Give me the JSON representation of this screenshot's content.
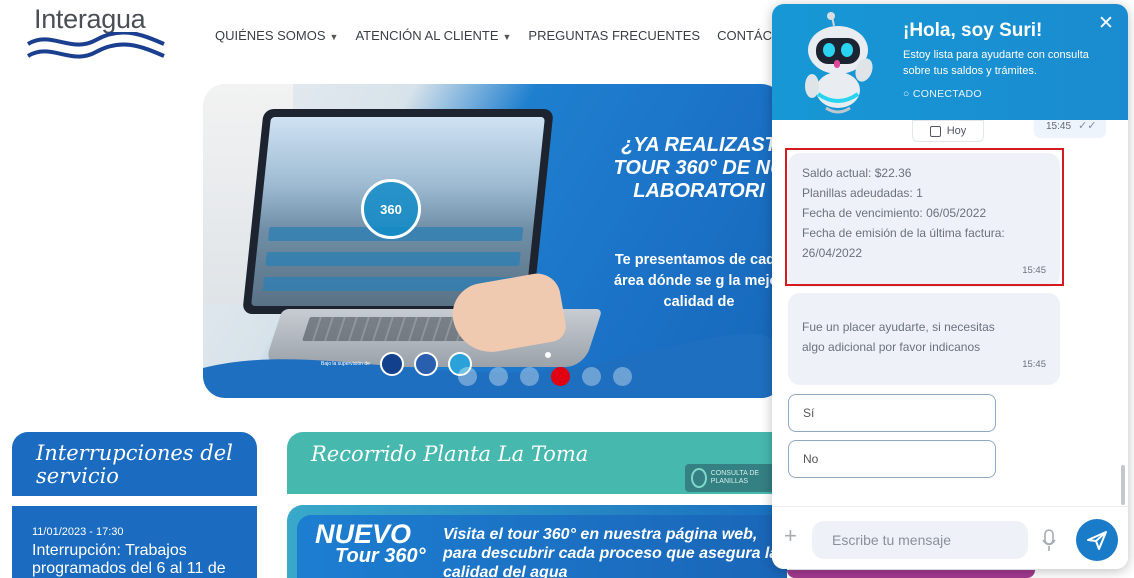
{
  "header": {
    "logo_text": "Interagua",
    "nav": [
      {
        "label": "QUIÉNES SOMOS",
        "dropdown": true
      },
      {
        "label": "ATENCIÓN AL CLIENTE",
        "dropdown": true
      },
      {
        "label": "PREGUNTAS FRECUENTES",
        "dropdown": false
      },
      {
        "label": "CONTÁCTANOS",
        "dropdown": true
      }
    ]
  },
  "hero": {
    "title": "¿YA REALIZAST TOUR 360° DE NU LABORATORI",
    "subtitle": "Te presentamos de cada área dónde se g la mejor calidad de",
    "badge": "360",
    "slides": 6,
    "active_slide": 4,
    "small_text": "Bajo la supervisión de"
  },
  "interruptions": {
    "title": "Interrupciones del servicio",
    "date": "11/01/2023 - 17:30",
    "text": "Interrupción: Trabajos programados del 6 al 11 de"
  },
  "recorrido": {
    "title": "Recorrido Planta La Toma",
    "consulta": "CONSULTA DE PLANILLAS"
  },
  "tour_banner": {
    "nuevo": "NUEVO",
    "tour": "Tour 360°",
    "text": "Visita el tour 360° en nuestra página web, para descubrir cada proceso que asegura la calidad del agua"
  },
  "chat": {
    "hello": "¡Hola, soy Suri!",
    "description": "Estoy lista para ayudarte con consulta sobre tus saldos y trámites.",
    "status": "○ CONECTADO",
    "close": "✕",
    "date_chip": "Hoy",
    "sent_time": "15:45",
    "sent_check": "✓✓",
    "balance_message": {
      "lines": [
        "Saldo actual: $22.36",
        "Planillas adeudadas: 1",
        "Fecha de vencimiento: 06/05/2022",
        "Fecha de emisión de la última factura:",
        "26/04/2022"
      ],
      "time": "15:45"
    },
    "followup_message": {
      "lines": [
        "Fue un placer ayudarte, si necesitas",
        "algo adicional por favor indicanos"
      ],
      "time": "15:45"
    },
    "options": [
      "Sí",
      "No"
    ],
    "input_placeholder": "Escribe tu mensaje",
    "plus": "+"
  },
  "colors": {
    "brand_blue": "#1a7cc8",
    "highlight_red": "#d71920",
    "teal": "#47b8ae",
    "active_dot": "#e00012"
  }
}
